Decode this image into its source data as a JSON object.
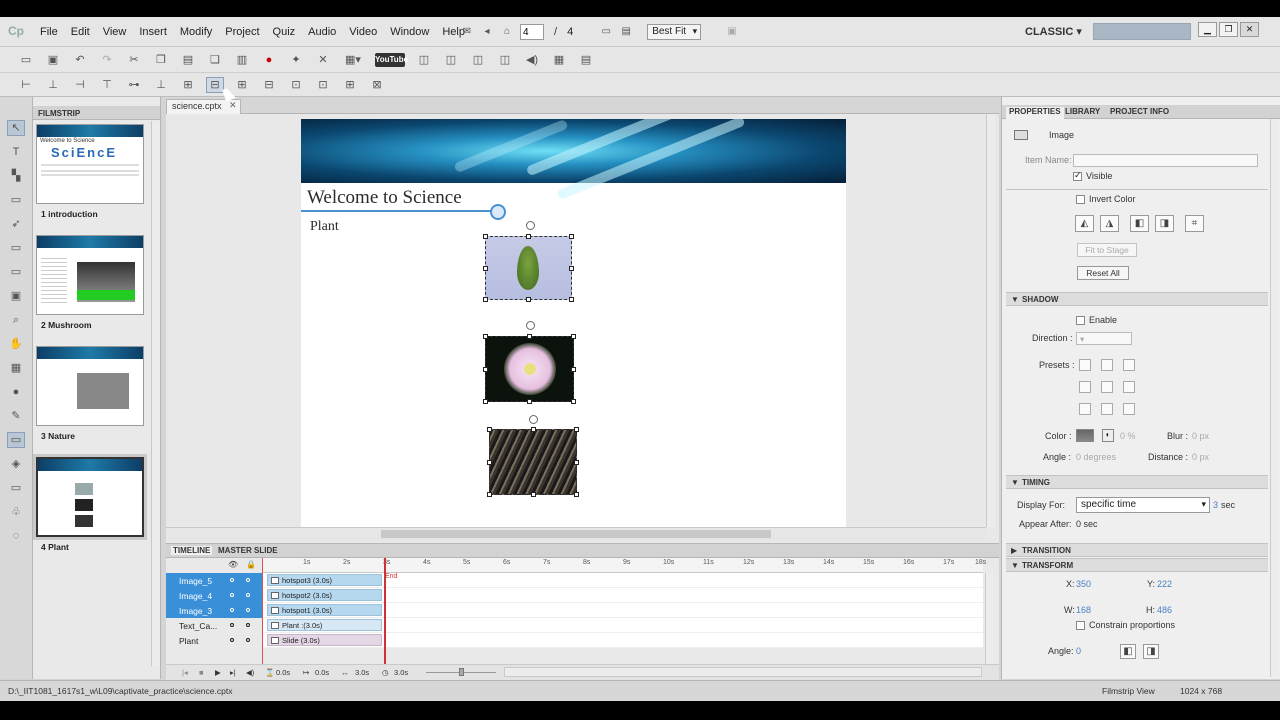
{
  "menu": {
    "items": [
      "File",
      "Edit",
      "View",
      "Insert",
      "Modify",
      "Project",
      "Quiz",
      "Audio",
      "Video",
      "Window",
      "Help"
    ]
  },
  "navigation": {
    "current_slide": "4",
    "separator": "/",
    "total_slides": "4",
    "zoom": "Best Fit"
  },
  "workspace": "CLASSIC",
  "toolbar": {
    "youtube_label": "YouTube"
  },
  "filmstrip": {
    "title": "FILMSTRIP",
    "slides": [
      {
        "label": "1 introduction"
      },
      {
        "label": "2 Mushroom"
      },
      {
        "label": "3 Nature"
      },
      {
        "label": "4 Plant"
      }
    ]
  },
  "document": {
    "tab_label": "science.cptx"
  },
  "stage": {
    "title": "Welcome to Science",
    "subtitle": "Plant"
  },
  "timeline": {
    "tabs": [
      "TIMELINE",
      "MASTER SLIDE"
    ],
    "layers": [
      {
        "name": "Image_5",
        "selected": true
      },
      {
        "name": "Image_4",
        "selected": true
      },
      {
        "name": "Image_3",
        "selected": true
      },
      {
        "name": "Text_Ca...",
        "selected": false
      },
      {
        "name": "Plant",
        "selected": false
      }
    ],
    "bars": [
      {
        "label": "hotspot3 (3.0s)"
      },
      {
        "label": "hotspot2 (3.0s)"
      },
      {
        "label": "hotspot1 (3.0s)"
      },
      {
        "label": "Plant :(3.0s)"
      },
      {
        "label": "Slide (3.0s)"
      }
    ],
    "ticks": [
      "1s",
      "2s",
      "3s",
      "4s",
      "5s",
      "6s",
      "7s",
      "8s",
      "9s",
      "10s",
      "11s",
      "12s",
      "13s",
      "14s",
      "15s",
      "16s",
      "17s",
      "18s"
    ],
    "end_label": "End",
    "footer": {
      "current": "0.0s",
      "start": "0.0s",
      "duration": "3.0s",
      "total": "3.0s"
    }
  },
  "properties": {
    "tabs": [
      "PROPERTIES",
      "LIBRARY",
      "PROJECT INFO"
    ],
    "object_type": "Image",
    "item_name_label": "Item Name:",
    "visible_label": "Visible",
    "invert_color_label": "Invert Color",
    "fit_to_stage_label": "Fit to Stage",
    "reset_all_label": "Reset All",
    "shadow": {
      "title": "SHADOW",
      "enable_label": "Enable",
      "direction_label": "Direction :",
      "presets_label": "Presets :",
      "color_label": "Color :",
      "opacity_value": "0 %",
      "blur_label": "Blur :",
      "blur_value": "0 px",
      "angle_label": "Angle :",
      "angle_value": "0 degrees",
      "distance_label": "Distance :",
      "distance_value": "0 px"
    },
    "timing": {
      "title": "TIMING",
      "display_for_label": "Display For:",
      "display_for_value": "specific time",
      "duration_value": "3",
      "duration_unit": "sec",
      "appear_after_label": "Appear After:",
      "appear_after_value": "0 sec"
    },
    "transition": {
      "title": "TRANSITION"
    },
    "transform": {
      "title": "TRANSFORM",
      "x_label": "X:",
      "x_value": "350",
      "y_label": "Y:",
      "y_value": "222",
      "w_label": "W:",
      "w_value": "168",
      "h_label": "H:",
      "h_value": "486",
      "constrain_label": "Constrain proportions",
      "angle_label": "Angle:",
      "angle_value": "0"
    }
  },
  "status": {
    "path": "D:\\_IIT1081_1617s1_w\\L09\\captivate_practice\\science.cptx",
    "view": "Filmstrip View",
    "resolution": "1024 x 768"
  }
}
